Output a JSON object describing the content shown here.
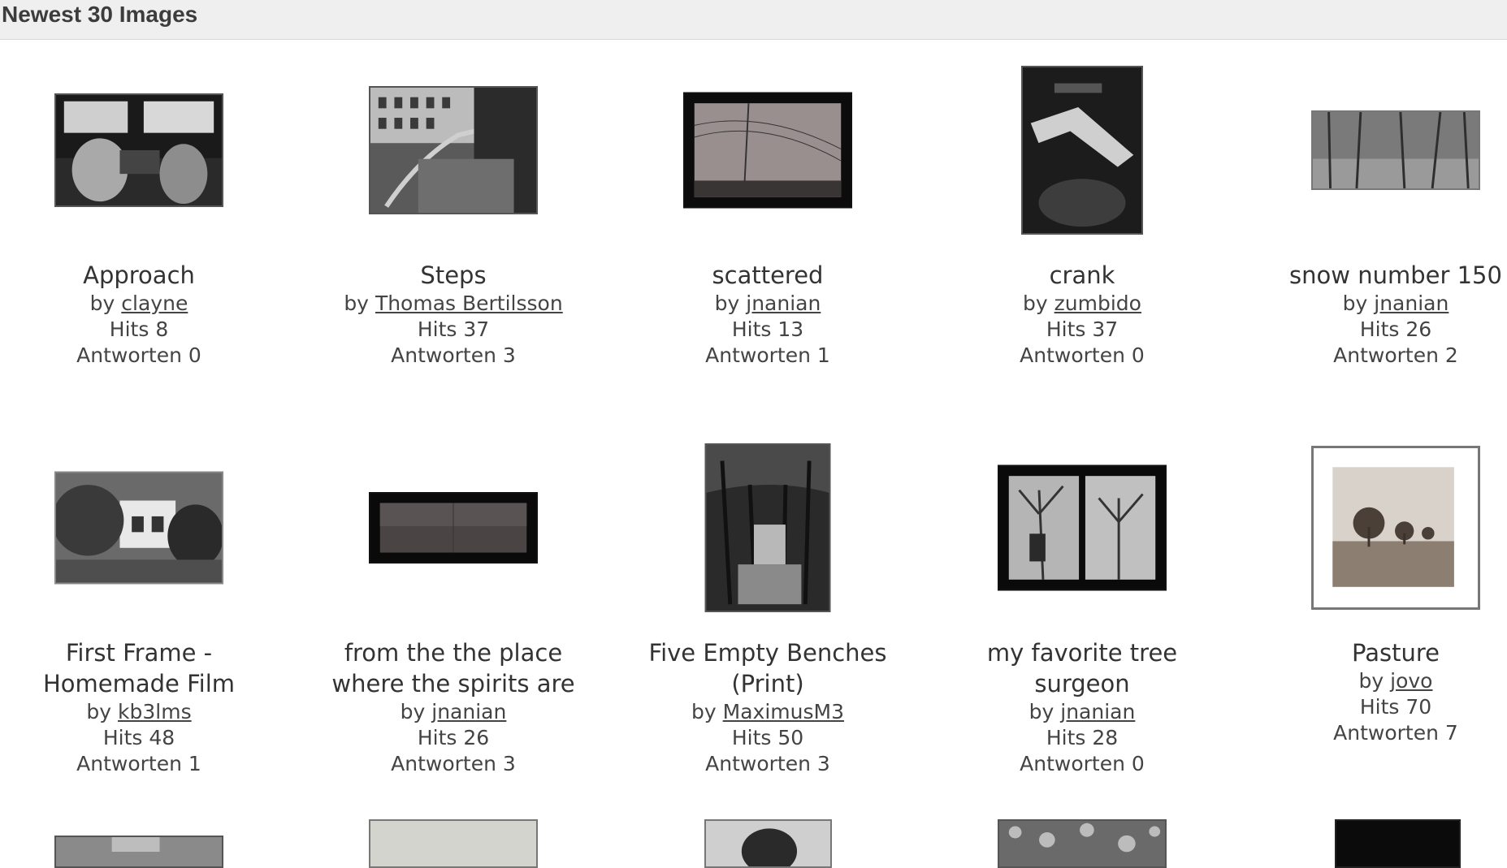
{
  "header": {
    "title": "Newest 30 Images"
  },
  "labels": {
    "by": "by",
    "hits": "Hits",
    "replies": "Antworten"
  },
  "row1": [
    {
      "title": "Approach",
      "author": "clayne",
      "hits": "8",
      "replies": "0",
      "thumb": "cockpit-photo"
    },
    {
      "title": "Steps",
      "author": "Thomas Bertilsson",
      "hits": "37",
      "replies": "3",
      "thumb": "steps-photo"
    },
    {
      "title": "scattered",
      "author": "jnanian",
      "hits": "13",
      "replies": "1",
      "thumb": "powerline-photo"
    },
    {
      "title": "crank",
      "author": "zumbido",
      "hits": "37",
      "replies": "0",
      "thumb": "crank-photo"
    },
    {
      "title": "snow number 150",
      "author": "jnanian",
      "hits": "26",
      "replies": "2",
      "thumb": "snow-trees-photo"
    }
  ],
  "row2": [
    {
      "title_line1": "First Frame -",
      "title_line2": "Homemade Film",
      "author": "kb3lms",
      "hits": "48",
      "replies": "1",
      "thumb": "house-tree-photo"
    },
    {
      "title_line1": "from the the place",
      "title_line2": "where the spirits are",
      "author": "jnanian",
      "hits": "26",
      "replies": "3",
      "thumb": "dark-landscape-photo"
    },
    {
      "title_line1": "Five Empty Benches",
      "title_line2": "(Print)",
      "author": "MaximusM3",
      "hits": "50",
      "replies": "3",
      "thumb": "benches-photo"
    },
    {
      "title_line1": "my favorite tree",
      "title_line2": "surgeon",
      "author": "jnanian",
      "hits": "28",
      "replies": "0",
      "thumb": "tree-surgeon-photo"
    },
    {
      "title": "Pasture",
      "author": "jovo",
      "hits": "70",
      "replies": "7",
      "thumb": "pasture-photo"
    }
  ],
  "row3": [
    {
      "thumb": "partial-photo-1"
    },
    {
      "thumb": "partial-photo-2"
    },
    {
      "thumb": "partial-photo-3"
    },
    {
      "thumb": "partial-photo-4"
    },
    {
      "thumb": "partial-photo-5"
    }
  ]
}
